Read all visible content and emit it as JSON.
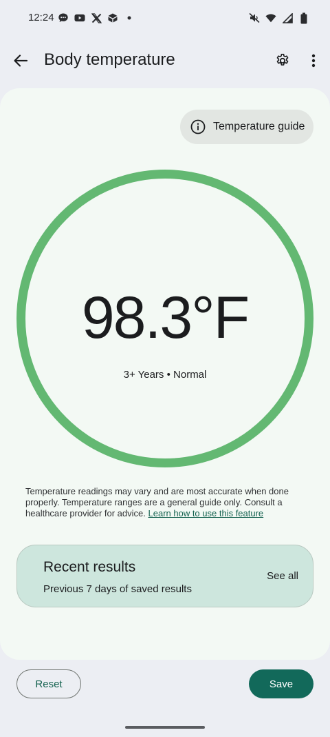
{
  "status_bar": {
    "time": "12:24",
    "left_icons": [
      "chat-bubble-icon",
      "youtube-icon",
      "x-icon",
      "box-icon",
      "dot-icon"
    ],
    "right_icons": [
      "mute-icon",
      "wifi-icon",
      "signal-icon",
      "battery-icon"
    ]
  },
  "app_bar": {
    "title": "Body temperature",
    "back_icon": "arrow-back-icon",
    "settings_icon": "gear-icon",
    "more_icon": "more-vert-icon"
  },
  "guide_chip": {
    "label": "Temperature guide",
    "icon": "info-icon"
  },
  "reading": {
    "value": "98.3°F",
    "status": "3+ Years • Normal",
    "ring_color": "#63b872"
  },
  "disclaimer": {
    "text": "Temperature readings may vary and are most accurate when done properly. Temperature ranges are a general guide only. Consult a healthcare provider for advice.",
    "link": "Learn how to use this feature"
  },
  "recent_results": {
    "title": "Recent results",
    "subtitle": "Previous 7 days of saved results",
    "action": "See all"
  },
  "actions": {
    "reset": "Reset",
    "save": "Save"
  },
  "colors": {
    "accent": "#12695a",
    "card_bg": "#f3f9f4",
    "recent_bg": "#cde6dd"
  }
}
